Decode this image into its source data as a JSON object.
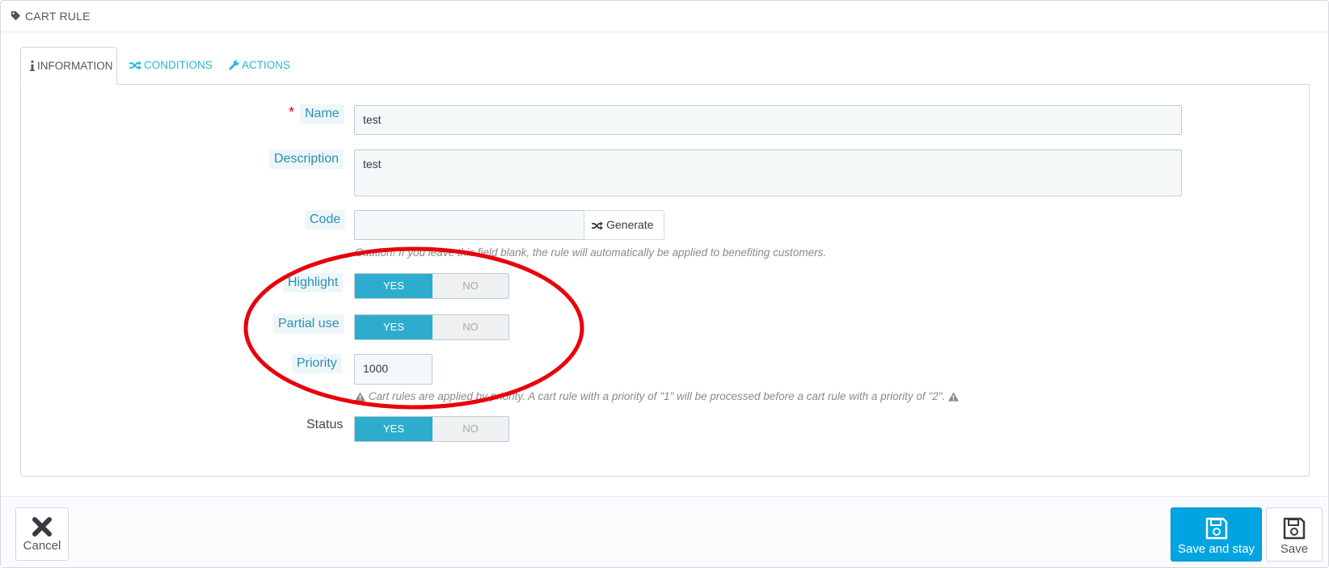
{
  "panel": {
    "title": "CART RULE",
    "icon": "tag-icon"
  },
  "tabs": [
    {
      "label": "INFORMATION",
      "icon": "info-icon",
      "active": true
    },
    {
      "label": "CONDITIONS",
      "icon": "random-icon",
      "active": false
    },
    {
      "label": "ACTIONS",
      "icon": "wrench-icon",
      "active": false
    }
  ],
  "form": {
    "name": {
      "label": "Name",
      "required_mark": "*",
      "value": "test"
    },
    "description": {
      "label": "Description",
      "value": "test"
    },
    "code": {
      "label": "Code",
      "value": "",
      "generate_label": "Generate",
      "help": "Caution! If you leave this field blank, the rule will automatically be applied to benefiting customers."
    },
    "highlight": {
      "label": "Highlight",
      "yes": "YES",
      "no": "NO",
      "selected": "YES"
    },
    "partial_use": {
      "label": "Partial use",
      "yes": "YES",
      "no": "NO",
      "selected": "YES"
    },
    "priority": {
      "label": "Priority",
      "value": "1000",
      "help": "Cart rules are applied by priority. A cart rule with a priority of \"1\" will be processed before a cart rule with a priority of \"2\"."
    },
    "status": {
      "label": "Status",
      "yes": "YES",
      "no": "NO",
      "selected": "YES"
    }
  },
  "footer": {
    "cancel_label": "Cancel",
    "save_and_stay_label": "Save and stay",
    "save_label": "Save"
  },
  "colors": {
    "accent": "#25b9d7",
    "primary_button": "#00a4e0",
    "switch_on": "#2eacce",
    "annotation": "#e8000b"
  }
}
